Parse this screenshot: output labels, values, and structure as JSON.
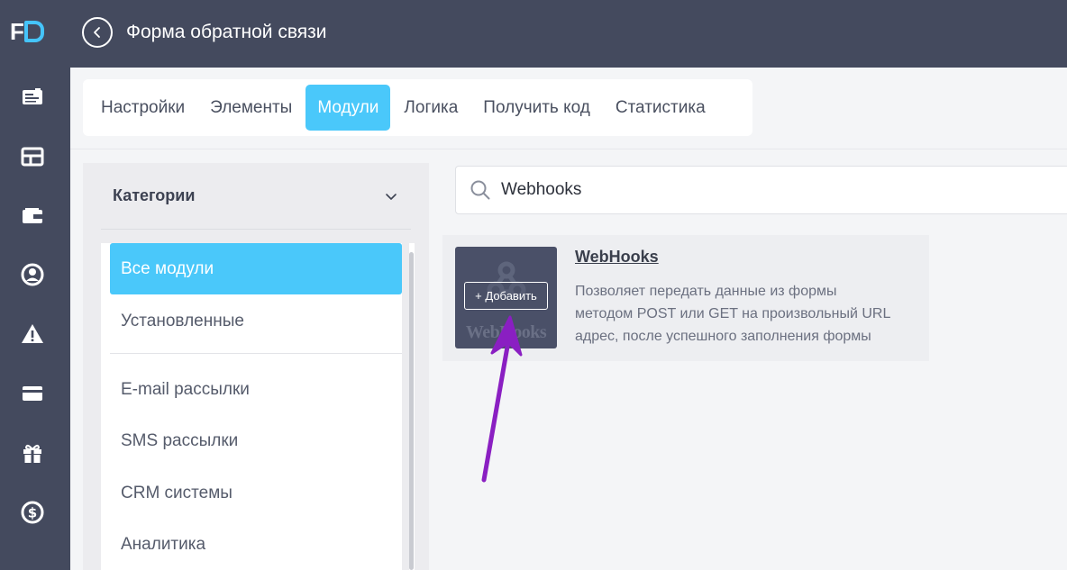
{
  "app": {
    "logo": {
      "letter_f": "F"
    },
    "page_title": "Форма обратной связи"
  },
  "rail": {
    "icons": [
      "forms-icon",
      "layout-icon",
      "wallet-icon",
      "user-circle-icon",
      "warning-icon",
      "credit-card-icon",
      "gift-icon",
      "dollar-icon"
    ]
  },
  "tabs": [
    {
      "label": "Настройки",
      "active": false
    },
    {
      "label": "Элементы",
      "active": false
    },
    {
      "label": "Модули",
      "active": true
    },
    {
      "label": "Логика",
      "active": false
    },
    {
      "label": "Получить код",
      "active": false
    },
    {
      "label": "Статистика",
      "active": false
    }
  ],
  "categories": {
    "title": "Категории",
    "items": [
      {
        "label": "Все модули",
        "active": true
      },
      {
        "label": "Установленные",
        "active": false
      },
      {
        "label": "E-mail рассылки",
        "active": false
      },
      {
        "label": "SMS рассылки",
        "active": false
      },
      {
        "label": "CRM системы",
        "active": false
      },
      {
        "label": "Аналитика",
        "active": false
      }
    ]
  },
  "search": {
    "value": "Webhooks"
  },
  "module": {
    "name": "WebHooks",
    "thumb_text": "WebHooks",
    "add_label": "+ Добавить",
    "description": "Позволяет передать данные из формы методом POST или GET на произвольный URL адрес, после успешного заполнения формы"
  },
  "colors": {
    "accent": "#4ac8fa",
    "rail": "#444a5e",
    "annotation_arrow": "#8a1fc2"
  }
}
